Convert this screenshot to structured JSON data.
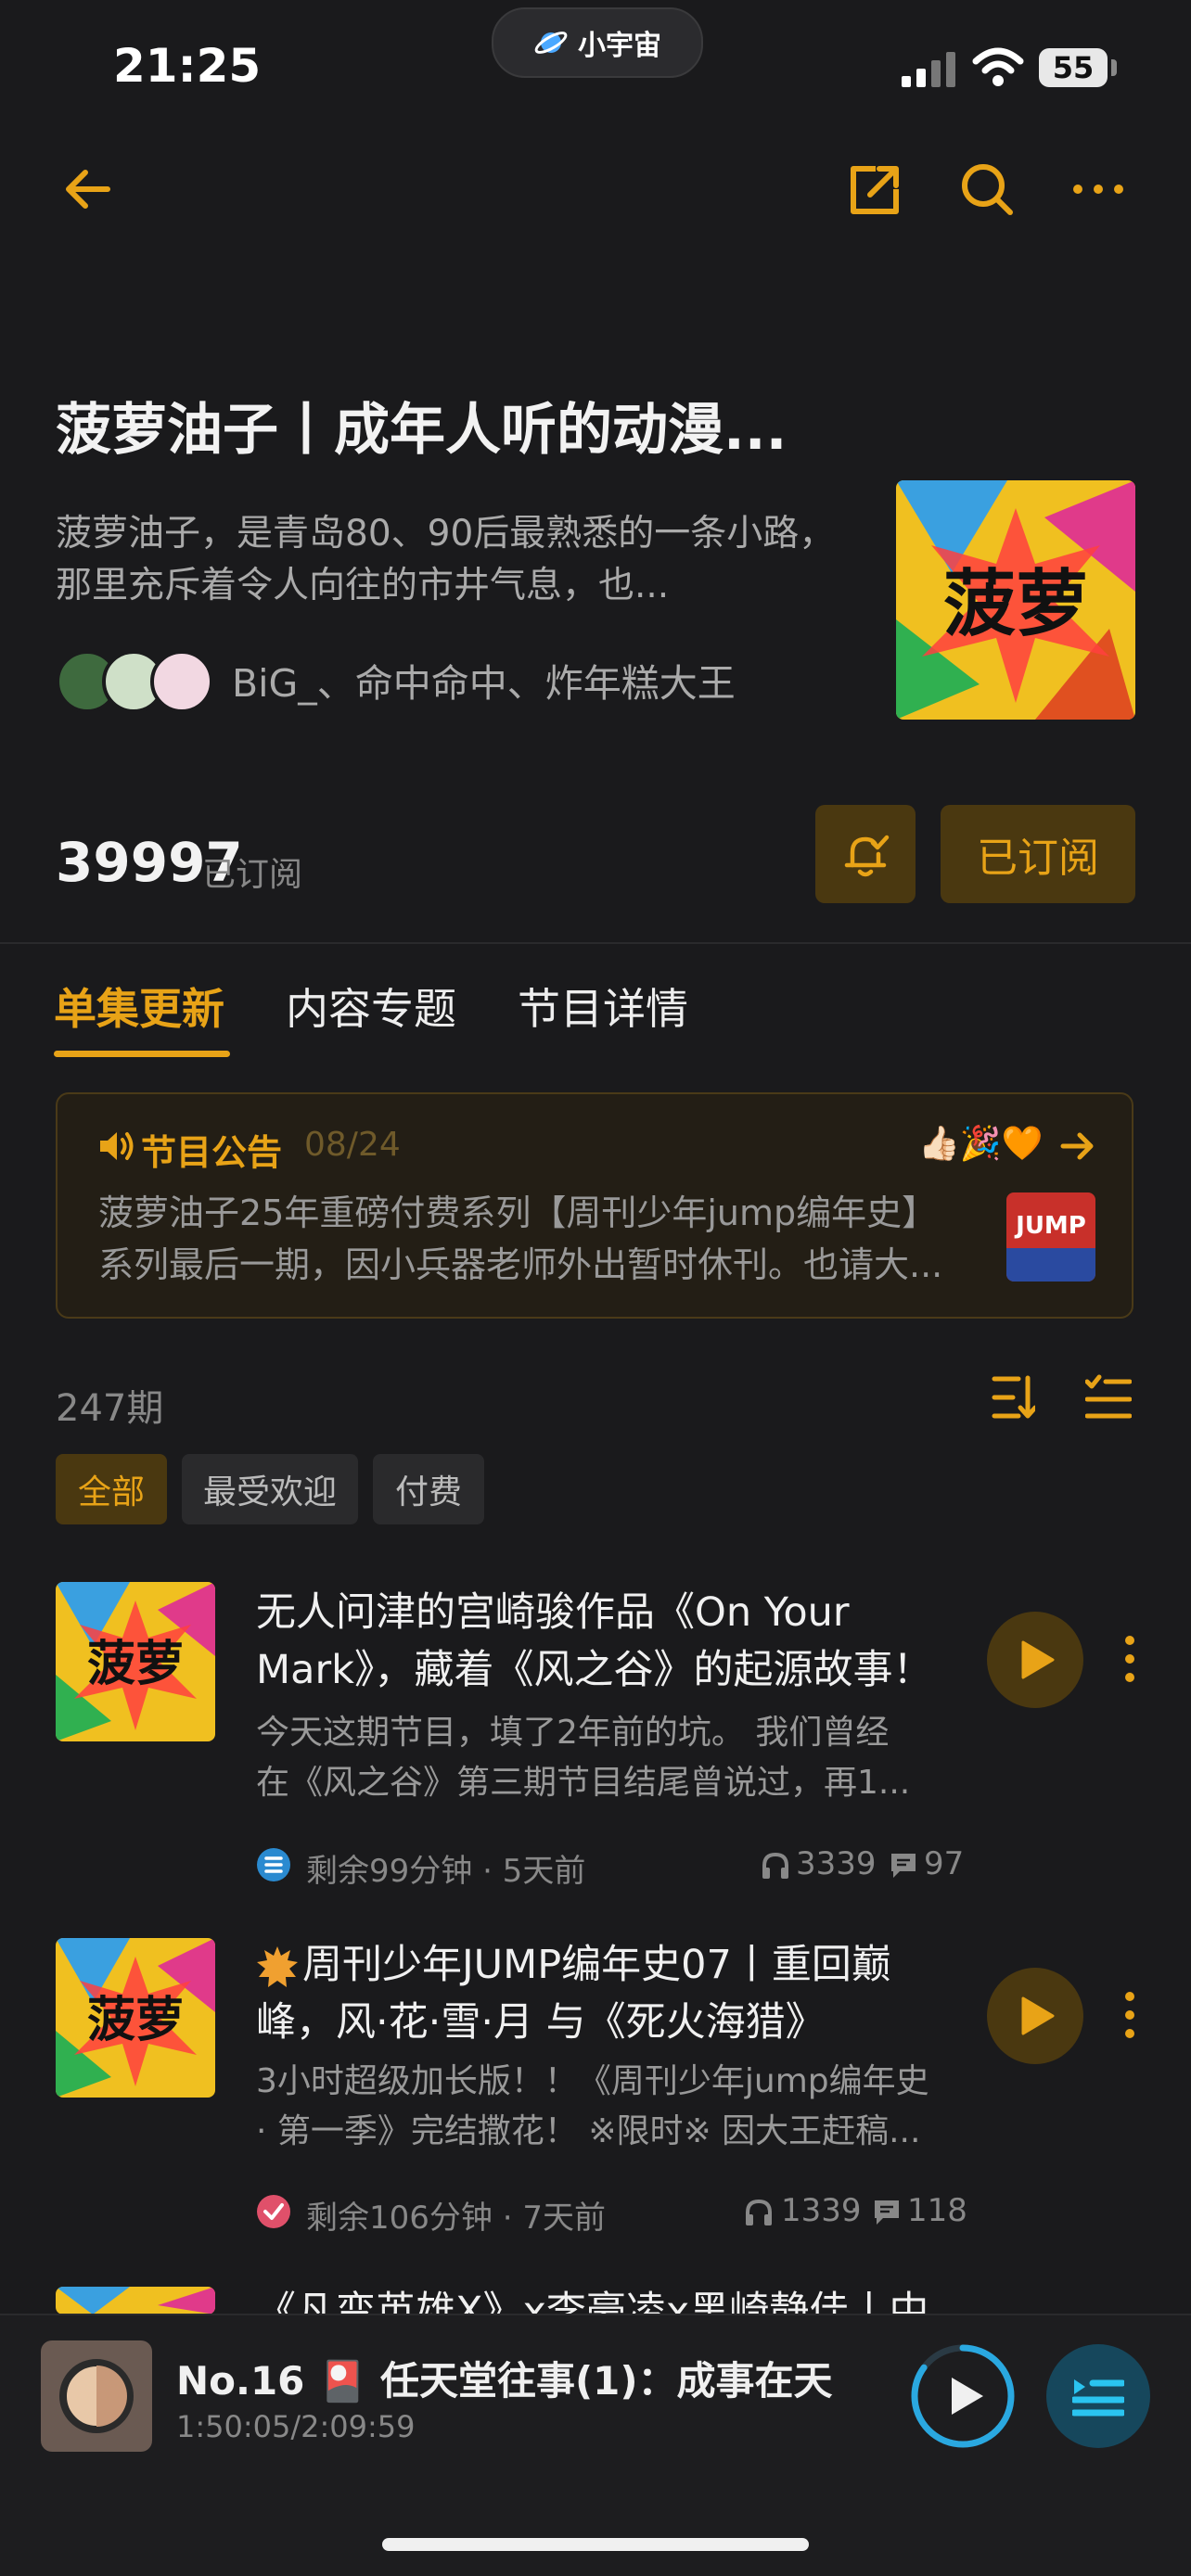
{
  "status_bar": {
    "time": "21:25",
    "island_label": "小宇宙",
    "battery": "55"
  },
  "podcast": {
    "title": "菠萝油子丨成年人听的动漫...",
    "description": "菠萝油子，是青岛80、90后最熟悉的一条小路，那里充斥着令人向往的市井气息，也...",
    "hosts": "BiG_、命中命中、炸年糕大王",
    "subscriber_count": "39997",
    "subscriber_label": "已订阅",
    "subscribe_button": "已订阅",
    "cover_text": "菠萝"
  },
  "tabs": [
    {
      "label": "单集更新"
    },
    {
      "label": "内容专题"
    },
    {
      "label": "节目详情"
    }
  ],
  "notice": {
    "title": "节目公告",
    "date": "08/24",
    "emojis": "👍🏻🎉🧡",
    "text": "菠萝油子25年重磅付费系列【周刊少年jump编年史】系列最后一期，因小兵器老师外出暂时休刊。也请大...",
    "thumb_text": "JUMP"
  },
  "episodes_header": {
    "count": "247期"
  },
  "filters": [
    {
      "label": "全部"
    },
    {
      "label": "最受欢迎"
    },
    {
      "label": "付费"
    }
  ],
  "episodes": [
    {
      "title": "无人问津的宫崎骏作品《On Your Mark》，藏着《风之谷》的起源故事！",
      "description_line1": "今天这期节目，填了2年前的坑。 我们曾经",
      "description_line2": "在《风之谷》第三期节目结尾曾说过，再1...",
      "remaining": "剩余99分钟 · 5天前",
      "plays": "3339",
      "comments": "97"
    },
    {
      "title": "周刊少年JUMP编年史07丨重回巅峰，风·花·雪·月 与《死火海猎》",
      "description_line1": "3小时超级加长版！！《周刊少年jump编年史",
      "description_line2": "· 第一季》完结撒花！ ※限时※ 因大王赶稿...",
      "remaining": "剩余106分钟 · 7天前",
      "plays": "1339",
      "comments": "118"
    },
    {
      "title": "《凡变英雄X》x李豪凌x黑崎静佳丨中"
    }
  ],
  "player": {
    "title": "No.16 🎴 任天堂往事(1)：成事在天",
    "time": "1:50:05/2:09:59",
    "progress": 0.85
  },
  "colors": {
    "accent": "#e8a317",
    "background": "#1a1a1c",
    "chip_bg": "#4a3810"
  }
}
